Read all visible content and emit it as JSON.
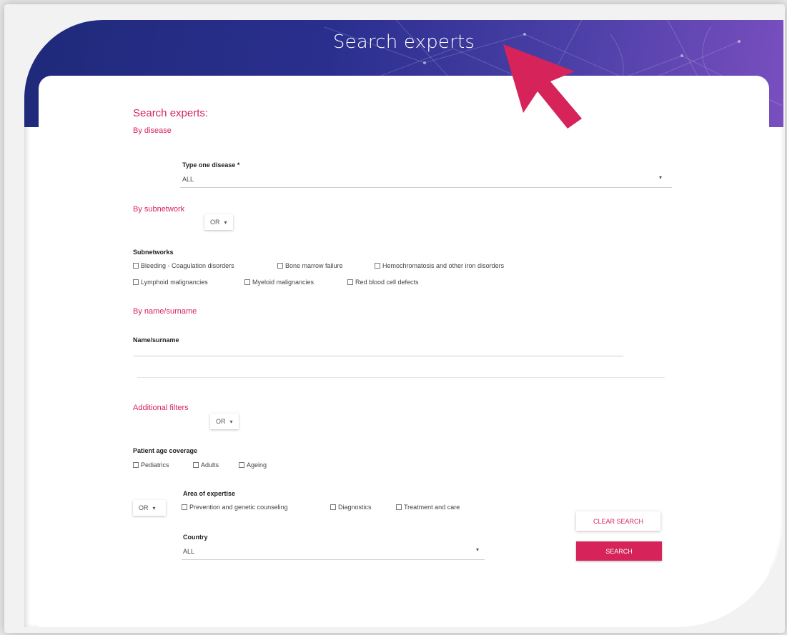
{
  "banner": {
    "title": "Search experts"
  },
  "form": {
    "heading": "Search experts:",
    "by_disease": {
      "title": "By disease",
      "field_label": "Type one disease *",
      "value": "ALL"
    },
    "by_subnetwork": {
      "title": "By subnetwork",
      "operator": "OR",
      "group_label": "Subnetworks",
      "options": [
        "Bleeding - Coagulation disorders",
        "Bone marrow failure",
        "Hemochromatosis and other iron disorders",
        "Lymphoid malignancies",
        "Myeloid malignancies",
        "Red blood cell defects"
      ]
    },
    "by_name": {
      "title": "By name/surname",
      "field_label": "Name/surname",
      "value": ""
    },
    "additional": {
      "title": "Additional filters",
      "operator": "OR",
      "age_label": "Patient age coverage",
      "age_options": [
        "Pediatrics",
        "Adults",
        "Ageing"
      ],
      "expertise_operator": "OR",
      "expertise_label": "Area of expertise",
      "expertise_options": [
        "Prevention and genetic counseling",
        "Diagnostics",
        "Treatment and care"
      ],
      "country_label": "Country",
      "country_value": "ALL"
    },
    "buttons": {
      "clear": "CLEAR SEARCH",
      "search": "SEARCH"
    }
  },
  "icons": {
    "caret": "caret-down-icon",
    "pointer": "arrow-pointer-icon",
    "checkbox": "checkbox-icon"
  },
  "colors": {
    "accent": "#d6245a",
    "banner_start": "#1f2a7a",
    "banner_end": "#7a4fc0"
  }
}
